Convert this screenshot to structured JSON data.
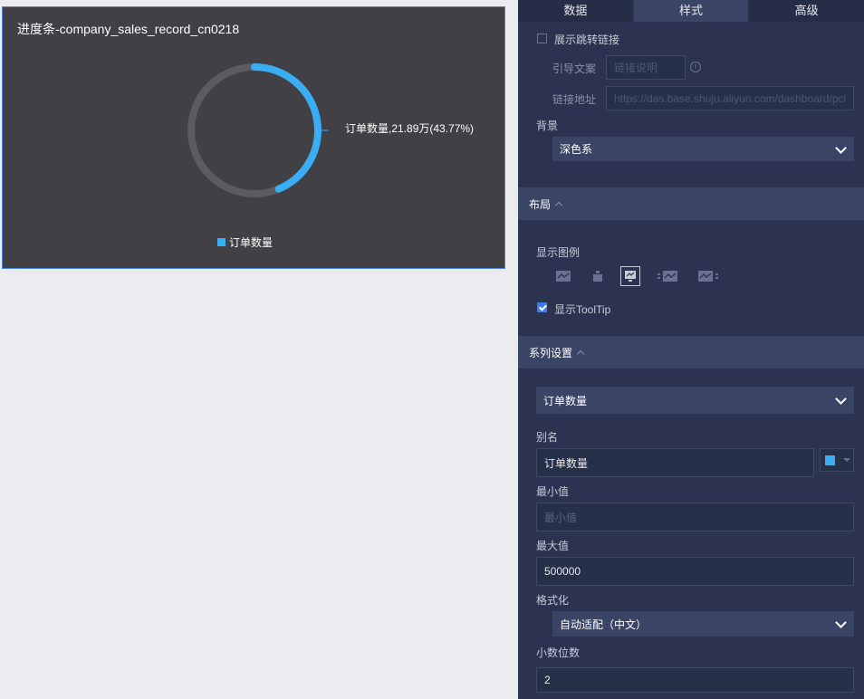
{
  "chart_card": {
    "title": "进度条-company_sales_record_cn0218",
    "data_label": "订单数量,21.89万(43.77%)",
    "legend_label": "订单数量"
  },
  "chart_data": {
    "type": "progress-ring",
    "series": [
      {
        "name": "订单数量",
        "value": 218850,
        "display_value": "21.89万",
        "percent": 43.77
      }
    ],
    "max": 500000,
    "colors": {
      "progress": "#3aaef5",
      "track": "#5c5c60"
    }
  },
  "tabs": [
    {
      "label": "数据"
    },
    {
      "label": "样式"
    },
    {
      "label": "高级"
    }
  ],
  "style": {
    "show_link_label": "展示跳转链接",
    "show_link_checked": false,
    "guide_text_label": "引导文案",
    "guide_text_placeholder": "链接说明",
    "link_url_label": "链接地址",
    "link_url_placeholder": "https://das.base.shuju.aliyun.com/dashboard/pcl",
    "background_label": "背景",
    "background_value": "深色系"
  },
  "layout_section": {
    "header": "布局",
    "show_legend_label": "显示图例",
    "legend_options": [
      {
        "icon": "legend-none-icon",
        "active": false
      },
      {
        "icon": "legend-top-icon",
        "active": false
      },
      {
        "icon": "legend-bottom-icon",
        "active": true
      },
      {
        "icon": "legend-left-icon",
        "active": false
      },
      {
        "icon": "legend-right-icon",
        "active": false
      }
    ],
    "show_tooltip_label": "显示ToolTip",
    "show_tooltip_checked": true
  },
  "series_section": {
    "header": "系列设置",
    "series_select": "订单数量",
    "alias_label": "别名",
    "alias_value": "订单数量",
    "series_color": "#3aaef5",
    "min_label": "最小值",
    "min_placeholder": "最小值",
    "max_label": "最大值",
    "max_value": "500000",
    "format_label": "格式化",
    "format_value": "自动适配（中文）",
    "decimals_label": "小数位数",
    "decimals_value": "2"
  }
}
